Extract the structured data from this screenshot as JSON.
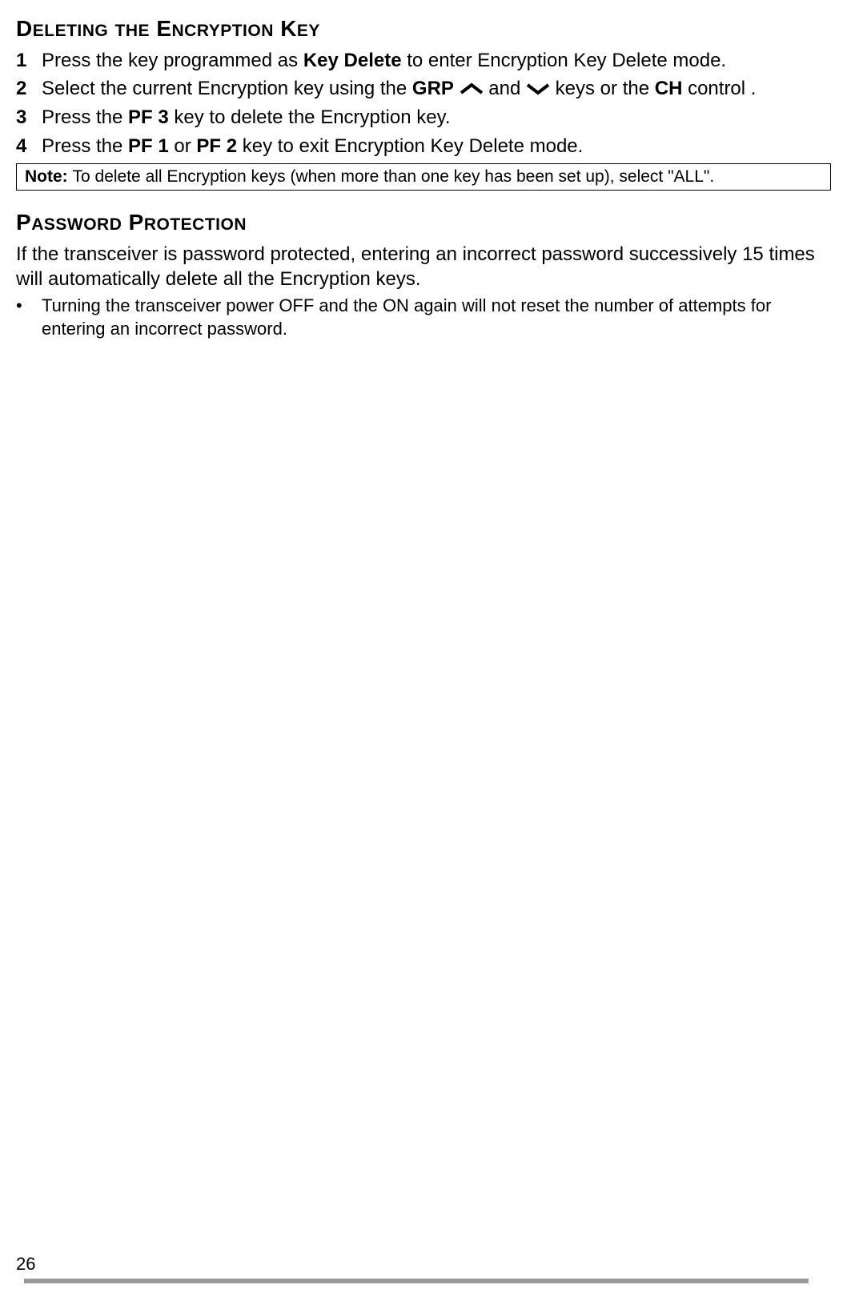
{
  "section1": {
    "heading": {
      "word1_first": "D",
      "word1_rest": "ELETING",
      "word2_first": "",
      "word2_rest": "THE",
      "word3_first": "E",
      "word3_rest": "NCRYPTION",
      "word4_first": "K",
      "word4_rest": "EY"
    },
    "steps": [
      {
        "num": "1",
        "parts": [
          {
            "text": "Press the key programmed as ",
            "bold": false
          },
          {
            "text": "Key Delete",
            "bold": true
          },
          {
            "text": " to enter Encryption Key Delete mode.",
            "bold": false
          }
        ]
      },
      {
        "num": "2",
        "parts": [
          {
            "text": "Select the current Encryption key using the ",
            "bold": false
          },
          {
            "text": "GRP",
            "bold": true
          },
          {
            "text": " ",
            "bold": false
          },
          {
            "icon": "up"
          },
          {
            "text": " and ",
            "bold": false
          },
          {
            "icon": "down"
          },
          {
            "text": " keys or the ",
            "bold": false
          },
          {
            "text": "CH",
            "bold": true
          },
          {
            "text": " control .",
            "bold": false
          }
        ]
      },
      {
        "num": "3",
        "parts": [
          {
            "text": "Press the ",
            "bold": false
          },
          {
            "text": "PF 3",
            "bold": true
          },
          {
            "text": " key to delete the Encryption key.",
            "bold": false
          }
        ]
      },
      {
        "num": "4",
        "parts": [
          {
            "text": "Press the ",
            "bold": false
          },
          {
            "text": "PF 1",
            "bold": true
          },
          {
            "text": " or ",
            "bold": false
          },
          {
            "text": "PF 2",
            "bold": true
          },
          {
            "text": " key to exit Encryption Key Delete mode.",
            "bold": false
          }
        ]
      }
    ],
    "note": {
      "label": "Note:  ",
      "text": "To delete all Encryption keys (when more than one key has been set up), select \"ALL\"."
    }
  },
  "section2": {
    "heading": {
      "word1_first": "P",
      "word1_rest": "ASSWORD",
      "word2_first": "P",
      "word2_rest": "ROTECTION"
    },
    "body": "If the transceiver is password protected, entering an incorrect password successively 15 times will automatically delete all the Encryption keys.",
    "bullet": {
      "marker": "•",
      "text": "Turning the transceiver power OFF and the ON again will not reset the number of attempts for entering an incorrect password."
    }
  },
  "pageNumber": "26"
}
